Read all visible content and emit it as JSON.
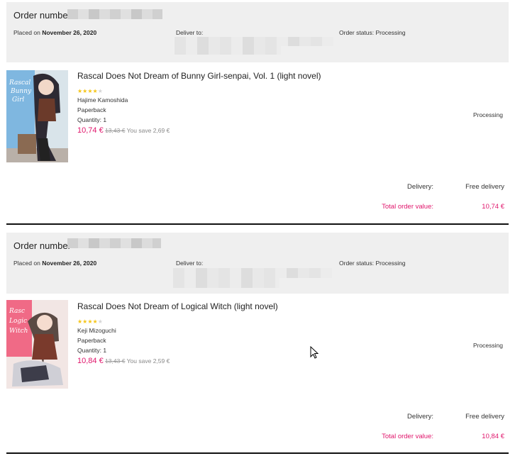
{
  "orders": [
    {
      "number_label": "Order number",
      "placed_prefix": "Placed on",
      "placed_date": "November 26, 2020",
      "deliver_label": "Deliver to:",
      "status_label": "Order status:",
      "status_value": "Processing",
      "item": {
        "title": "Rascal Does Not Dream of Bunny Girl-senpai, Vol. 1 (light novel)",
        "rating_stars": 4,
        "author": "Hajime Kamoshida",
        "format": "Paperback",
        "quantity": "Quantity: 1",
        "price": "10,74 €",
        "old_price": "13,43 €",
        "savings": "You save 2,69 €",
        "status": "Processing"
      },
      "delivery_label": "Delivery:",
      "delivery_value": "Free delivery",
      "total_label": "Total order value:",
      "total_value": "10,74 €"
    },
    {
      "number_label": "Order number",
      "placed_prefix": "Placed on",
      "placed_date": "November 26, 2020",
      "deliver_label": "Deliver to:",
      "status_label": "Order status:",
      "status_value": "Processing",
      "item": {
        "title": "Rascal Does Not Dream of Logical Witch (light novel)",
        "rating_stars": 4,
        "author": "Keji Mizoguchi",
        "format": "Paperback",
        "quantity": "Quantity: 1",
        "price": "10,84 €",
        "old_price": "13,43 €",
        "savings": "You save 2,59 €",
        "status": "Processing"
      },
      "delivery_label": "Delivery:",
      "delivery_value": "Free delivery",
      "total_label": "Total order value:",
      "total_value": "10,84 €"
    }
  ],
  "colors": {
    "accent": "#e0156b",
    "header_bg": "#efefef",
    "star": "#f5c518"
  },
  "icons": [
    "star-icon",
    "mouse-cursor-icon"
  ]
}
